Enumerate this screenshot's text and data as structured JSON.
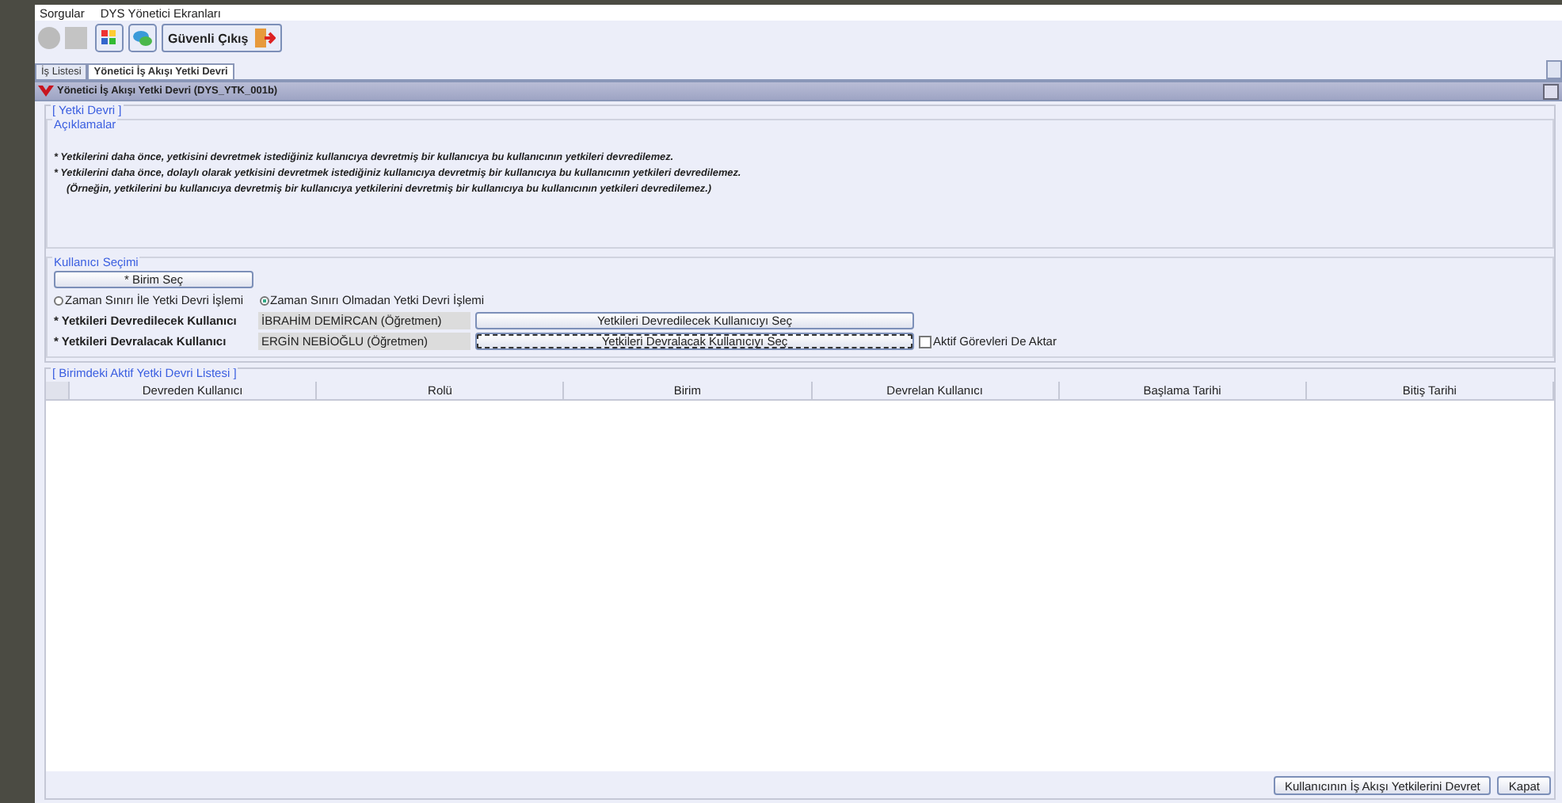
{
  "menu": [
    "Sorgular",
    "DYS Yönetici Ekranları"
  ],
  "toolbar": {
    "exit_button": "Güvenli Çıkış"
  },
  "tabs": [
    {
      "label": "İş Listesi",
      "selected": false
    },
    {
      "label": "Yönetici İş Akışı Yetki Devri",
      "selected": true
    }
  ],
  "panel_title": "Yönetici İş Akışı Yetki Devri (DYS_YTK_001b)",
  "yetki_devri": {
    "legend": "[ Yetki Devri ]",
    "notes_legend": "Açıklamalar",
    "notes": [
      {
        "text": "* Yetkilerini daha önce, yetkisini devretmek istediğiniz kullanıcıya devretmiş bir kullanıcıya bu kullanıcının yetkileri devredilemez.",
        "indented": false
      },
      {
        "text": "* Yetkilerini daha önce, dolaylı olarak yetkisini devretmek istediğiniz kullanıcıya devretmiş bir kullanıcıya bu kullanıcının yetkileri devredilemez.",
        "indented": false
      },
      {
        "text": "(Örneğin, yetkilerini bu kullanıcıya devretmiş bir kullanıcıya yetkilerini devretmiş bir kullanıcıya bu kullanıcının yetkileri devredilemez.)",
        "indented": true
      }
    ]
  },
  "user_selection": {
    "legend": "Kullanıcı Seçimi",
    "unit_button": "* Birim Seç",
    "radios": [
      {
        "label": "Zaman Sınırı İle Yetki Devri İşlemi",
        "selected": false
      },
      {
        "label": "Zaman Sınırı Olmadan Yetki Devri İşlemi",
        "selected": true
      }
    ],
    "rows": [
      {
        "label": "* Yetkileri Devredilecek Kullanıcı",
        "value": "İBRAHİM DEMİRCAN (Öğretmen)",
        "button": "Yetkileri Devredilecek Kullanıcıyı Seç",
        "focused": false
      },
      {
        "label": "* Yetkileri Devralacak Kullanıcı",
        "value": "ERGİN NEBİOĞLU (Öğretmen)",
        "button": "Yetkileri Devralacak Kullanıcıyı Seç",
        "focused": true
      }
    ],
    "checkbox": {
      "label": "Aktif Görevleri De Aktar",
      "checked": false
    }
  },
  "table": {
    "legend": "[ Birimdeki Aktif Yetki Devri Listesi ]",
    "columns": [
      "Devreden Kullanıcı",
      "Rolü",
      "Birim",
      "Devrelan Kullanıcı",
      "Başlama Tarihi",
      "Bitiş Tarihi"
    ]
  },
  "footer_buttons": [
    "Kullanıcının İş Akışı Yetkilerini Devret",
    "Kapat"
  ]
}
